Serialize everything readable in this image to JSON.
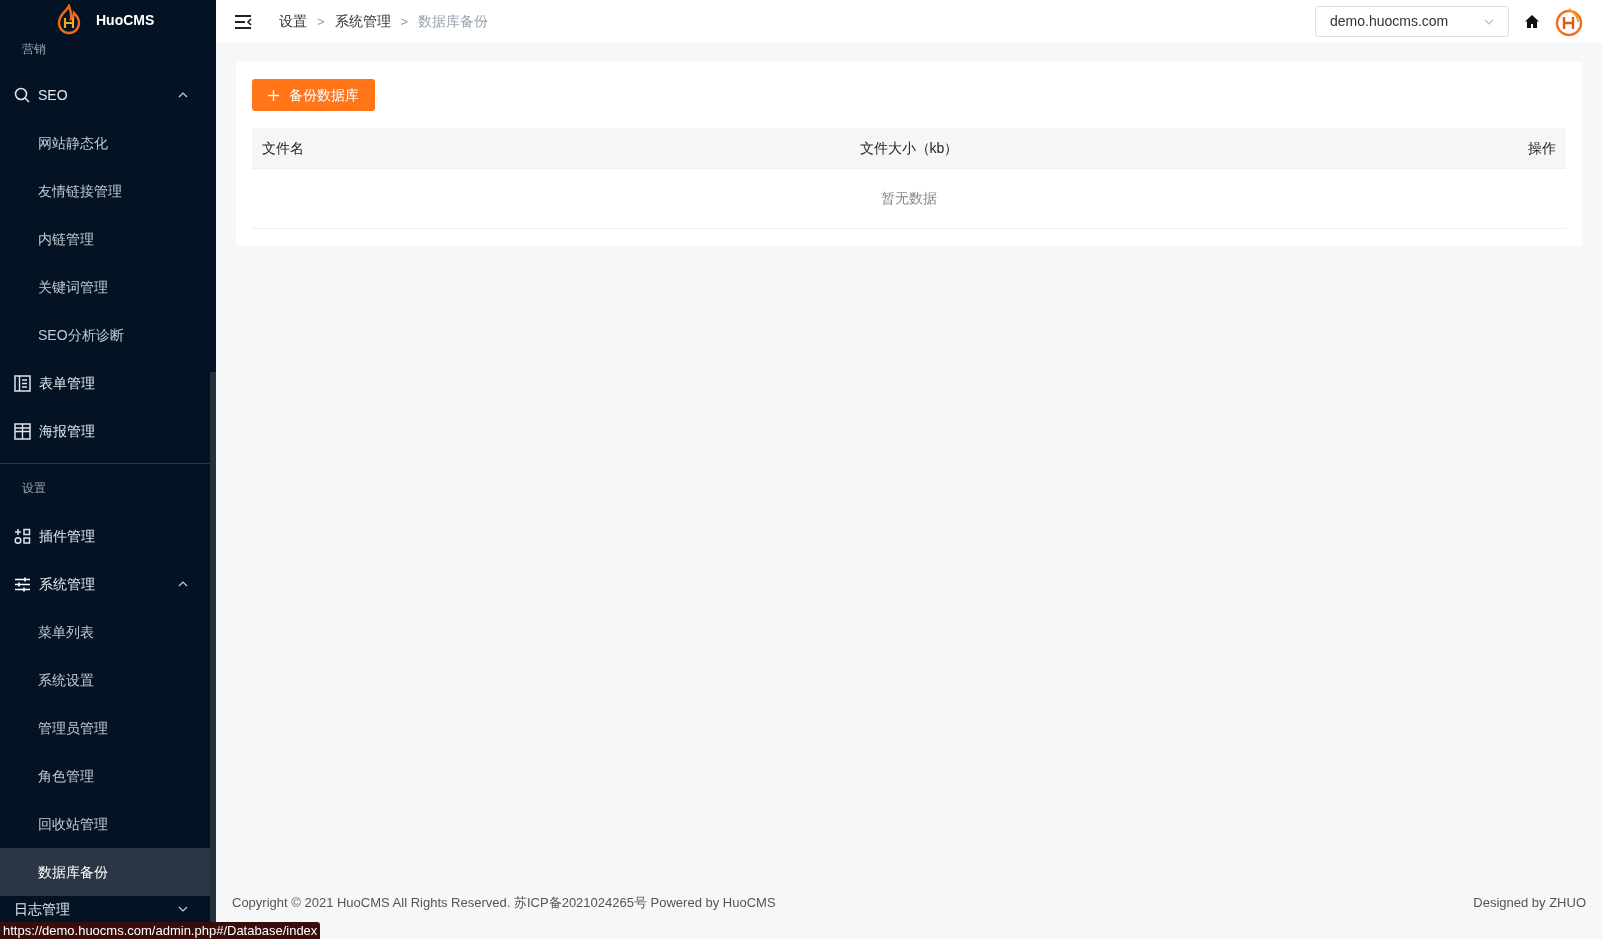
{
  "sidebar": {
    "logo_text": "HuoCMS",
    "items": [
      {
        "kind": "label",
        "label": "营销"
      },
      {
        "kind": "submenu",
        "label": "SEO",
        "expanded": true,
        "children": [
          {
            "label": "网站静态化",
            "selected": false
          },
          {
            "label": "友情链接管理",
            "selected": false
          },
          {
            "label": "内链管理",
            "selected": false
          },
          {
            "label": "关键词管理",
            "selected": false
          },
          {
            "label": "SEO分析诊断",
            "selected": false
          }
        ]
      },
      {
        "kind": "item",
        "label": "表单管理"
      },
      {
        "kind": "item",
        "label": "海报管理"
      },
      {
        "kind": "divider"
      },
      {
        "kind": "label",
        "label": "设置"
      },
      {
        "kind": "item",
        "label": "插件管理"
      },
      {
        "kind": "submenu",
        "label": "系统管理",
        "expanded": true,
        "children": [
          {
            "label": "菜单列表",
            "selected": false
          },
          {
            "label": "系统设置",
            "selected": false
          },
          {
            "label": "管理员管理",
            "selected": false
          },
          {
            "label": "角色管理",
            "selected": false
          },
          {
            "label": "回收站管理",
            "selected": false
          },
          {
            "label": "数据库备份",
            "selected": true
          }
        ]
      },
      {
        "kind": "submenu",
        "label": "日志管理",
        "expanded": false
      }
    ]
  },
  "header": {
    "breadcrumb": [
      {
        "label": "设置"
      },
      {
        "label": "系统管理"
      },
      {
        "label": "数据库备份"
      }
    ],
    "separator": ">",
    "site_select": {
      "value": "demo.huocms.com"
    }
  },
  "content": {
    "button": "备份数据库",
    "table": {
      "columns": [
        {
          "label": "文件名"
        },
        {
          "label": "文件大小（kb）"
        },
        {
          "label": "操作"
        }
      ],
      "empty_text": "暂无数据"
    }
  },
  "footer": {
    "copyright": "Copyright © 2021 HuoCMS All Rights Reserved. 苏ICP备2021024265号 Powered by HuoCMS",
    "designed_by": "Designed by ZHUO"
  },
  "status_url": "https://demo.huocms.com/admin.php#/Database/index"
}
